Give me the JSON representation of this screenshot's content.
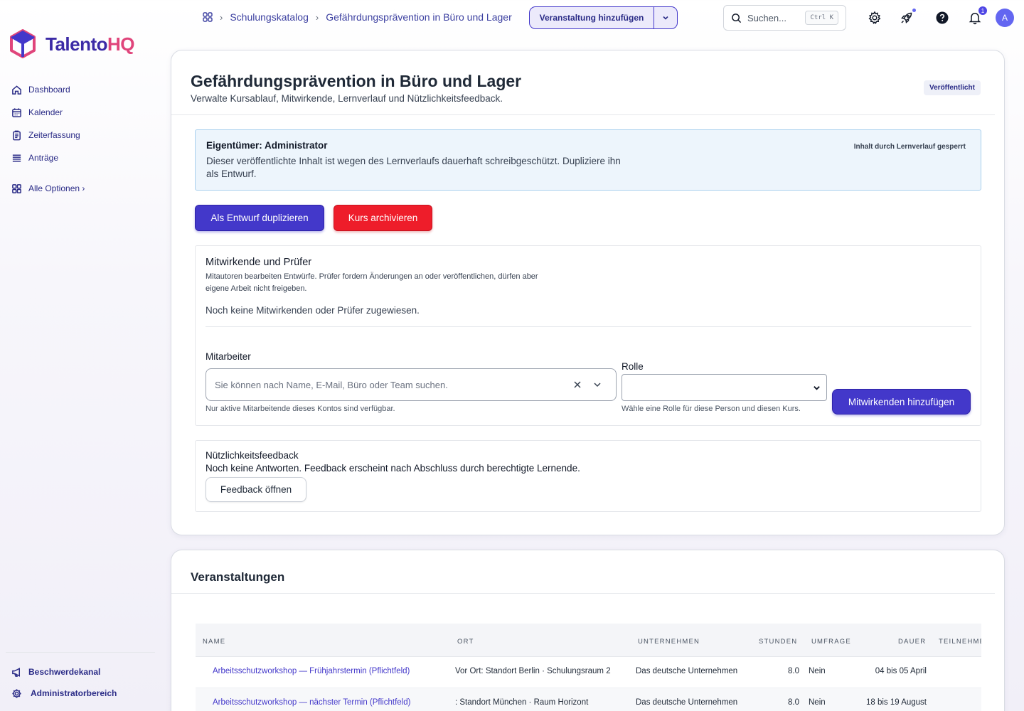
{
  "brand": {
    "name_main": "Talento",
    "name_accent": "HQ"
  },
  "sidebar": {
    "items": [
      {
        "label": "Dashboard"
      },
      {
        "label": "Kalender"
      },
      {
        "label": "Zeiterfassung"
      },
      {
        "label": "Anträge"
      }
    ],
    "all_options": "Alle Optionen ›",
    "bottom": [
      {
        "label": "Beschwerdekanal"
      },
      {
        "label": "Administratorbereich"
      }
    ]
  },
  "topbar": {
    "breadcrumb": [
      "Schulungskatalog",
      "Gefährdungsprävention in Büro und Lager"
    ],
    "add_event": "Veranstaltung hinzufügen",
    "search_placeholder": "Suchen...",
    "search_shortcut": "Ctrl K",
    "notification_count": "1",
    "avatar_initial": "A"
  },
  "course": {
    "title": "Gefährdungsprävention in Büro und Lager",
    "subtitle": "Verwalte Kursablauf, Mitwirkende, Lernverlauf und Nützlichkeitsfeedback.",
    "status": "Veröffentlicht"
  },
  "alert": {
    "owner": "Eigentümer: Administrator",
    "message": "Dieser veröffentlichte Inhalt ist wegen des Lernverlaufs dauerhaft schreibgeschützt. Dupliziere ihn als Entwurf.",
    "lock_note": "Inhalt durch Lernverlauf gesperrt"
  },
  "actions": {
    "duplicate": "Als Entwurf duplizieren",
    "archive": "Kurs archivieren"
  },
  "contributors": {
    "title": "Mitwirkende und Prüfer",
    "description": "Mitautoren bearbeiten Entwürfe. Prüfer fordern Änderungen an oder veröffentlichen, dürfen aber eigene Arbeit nicht freigeben.",
    "empty": "Noch keine Mitwirkenden oder Prüfer zugewiesen.",
    "employee_label": "Mitarbeiter",
    "employee_placeholder": "Sie können nach Name, E-Mail, Büro oder Team suchen.",
    "employee_hint": "Nur aktive Mitarbeitende dieses Kontos sind verfügbar.",
    "role_label": "Rolle",
    "role_value": "",
    "role_hint": "Wähle eine Rolle für diese Person und diesen Kurs.",
    "add_button": "Mitwirkenden hinzufügen"
  },
  "feedback": {
    "title": "Nützlichkeitsfeedback",
    "text": "Noch keine Antworten. Feedback erscheint nach Abschluss durch berechtigte Lernende.",
    "open_button": "Feedback öffnen"
  },
  "events": {
    "title": "Veranstaltungen",
    "columns": [
      "NAME",
      "ORT",
      "UNTERNEHMEN",
      "STUNDEN",
      "UMFRAGE",
      "DAUER",
      "TEILNEHME"
    ],
    "rows": [
      {
        "name": "Arbeitsschutzworkshop — Frühjahrstermin (Pflichtfeld)",
        "location": "Vor Ort: Standort Berlin · Schulungsraum 2",
        "company": "Das deutsche Unternehmen",
        "hours": "8.0",
        "survey": "Nein",
        "duration": "04 bis 05 April"
      },
      {
        "name": "Arbeitsschutzworkshop — nächster Termin (Pflichtfeld)",
        "location": ": Standort München · Raum Horizont",
        "company": "Das deutsche Unternehmen",
        "hours": "8.0",
        "survey": "Nein",
        "duration": "18 bis 19 August"
      }
    ]
  }
}
